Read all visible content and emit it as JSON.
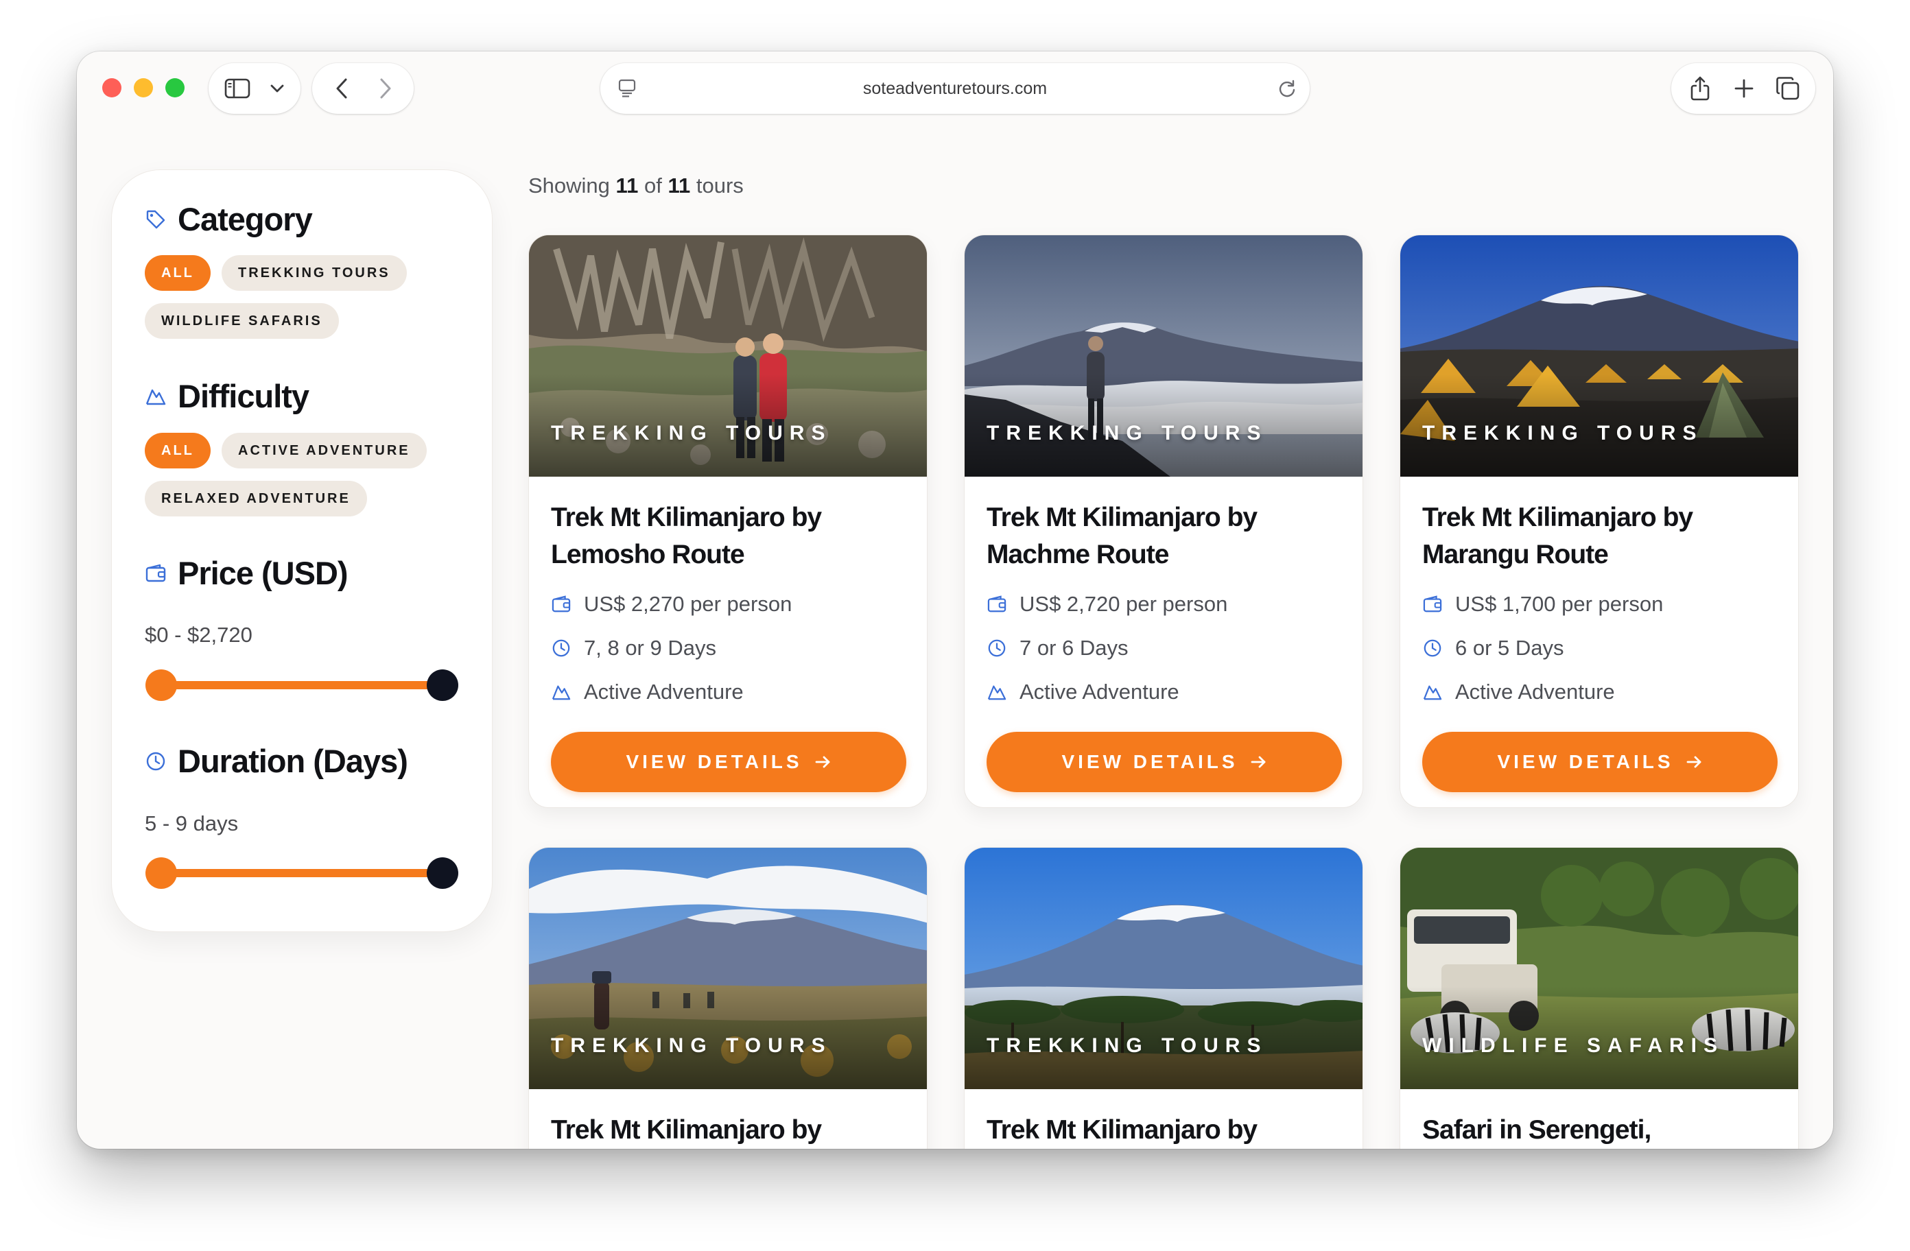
{
  "browser": {
    "url": "soteadventuretours.com",
    "traffic_lights": {
      "red": "#fe5f57",
      "yellow": "#febc2e",
      "green": "#28c840"
    }
  },
  "filters": {
    "category": {
      "title": "Category",
      "chips": [
        "ALL",
        "TREKKING TOURS",
        "WILDLIFE SAFARIS"
      ],
      "active": "ALL"
    },
    "difficulty": {
      "title": "Difficulty",
      "chips": [
        "ALL",
        "ACTIVE ADVENTURE",
        "RELAXED ADVENTURE"
      ],
      "active": "ALL"
    },
    "price": {
      "title": "Price (USD)",
      "range_text": "$0 - $2,720",
      "min": 0,
      "max": 2720
    },
    "duration": {
      "title": "Duration (Days)",
      "range_text": "5 - 9 days",
      "min": 5,
      "max": 9
    }
  },
  "results": {
    "prefix": "Showing",
    "shown": "11",
    "of": "of",
    "total": "11",
    "suffix": "tours"
  },
  "cards": [
    {
      "category": "TREKKING TOURS",
      "title": "Trek Mt Kilimanjaro by Lemosho Route",
      "price": "US$ 2,270 per person",
      "duration": "7, 8 or 9 Days",
      "difficulty": "Active Adventure",
      "button": "VIEW DETAILS"
    },
    {
      "category": "TREKKING TOURS",
      "title": "Trek Mt Kilimanjaro by Machme Route",
      "price": "US$ 2,720 per person",
      "duration": "7 or 6 Days",
      "difficulty": "Active Adventure",
      "button": "VIEW DETAILS"
    },
    {
      "category": "TREKKING TOURS",
      "title": "Trek Mt Kilimanjaro by Marangu Route",
      "price": "US$ 1,700 per person",
      "duration": "6 or 5 Days",
      "difficulty": "Active Adventure",
      "button": "VIEW DETAILS"
    },
    {
      "category": "TREKKING TOURS",
      "title": "Trek Mt Kilimanjaro by"
    },
    {
      "category": "TREKKING TOURS",
      "title": "Trek Mt Kilimanjaro by"
    },
    {
      "category": "WILDLIFE SAFARIS",
      "title": "Safari in Serengeti,"
    }
  ],
  "colors": {
    "accent": "#f57a1c",
    "icon_blue": "#3b6fd8",
    "knob_dark": "#0f1320",
    "chip_bg": "#efe9e2"
  }
}
